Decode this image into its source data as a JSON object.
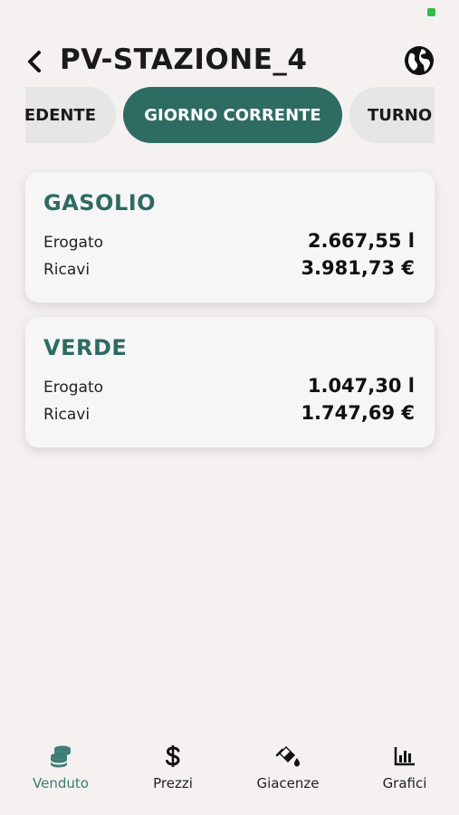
{
  "header": {
    "title": "PV-STAZIONE_4"
  },
  "tabs": [
    {
      "label": "EDENTE",
      "state": "partial"
    },
    {
      "label": "GIORNO CORRENTE",
      "state": "active"
    },
    {
      "label": "TURNO",
      "state": "partial"
    }
  ],
  "cards": [
    {
      "fuel": "GASOLIO",
      "rows": [
        {
          "label": "Erogato",
          "value": "2.667,55 l"
        },
        {
          "label": "Ricavi",
          "value": "3.981,73 €"
        }
      ]
    },
    {
      "fuel": "VERDE",
      "rows": [
        {
          "label": "Erogato",
          "value": "1.047,30 l"
        },
        {
          "label": "Ricavi",
          "value": "1.747,69 €"
        }
      ]
    }
  ],
  "bottom_nav": [
    {
      "label": "Venduto",
      "icon": "coins-icon",
      "active": true
    },
    {
      "label": "Prezzi",
      "icon": "dollar-icon",
      "active": false
    },
    {
      "label": "Giacenze",
      "icon": "paint-bucket-icon",
      "active": false
    },
    {
      "label": "Grafici",
      "icon": "bar-chart-icon",
      "active": false
    }
  ],
  "colors": {
    "accent": "#2e6b62",
    "background": "#f5f1f1",
    "status_green": "#2fbf4a"
  }
}
